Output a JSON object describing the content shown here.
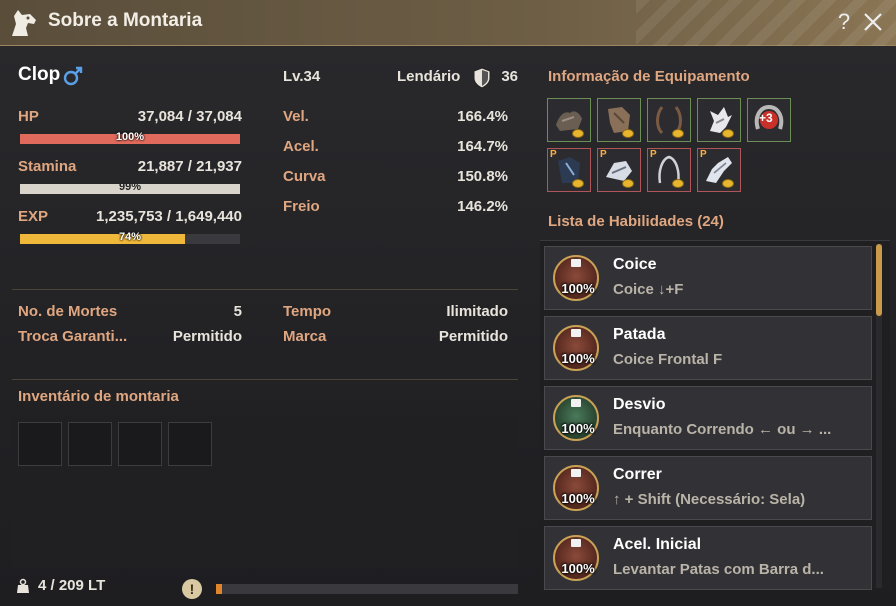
{
  "window": {
    "title": "Sobre a Montaria",
    "icon": "horse-head-icon",
    "help_label": "?"
  },
  "mount": {
    "name": "Clop",
    "gender": "male",
    "level": "Lv.34",
    "grade": "Lendário",
    "armor": "36",
    "stats": {
      "hp_label": "HP",
      "hp_value": "37,084 / 37,084",
      "hp_pct_label": "100%",
      "hp_fraction": 1.0,
      "stamina_label": "Stamina",
      "stamina_value": "21,887 / 21,937",
      "stamina_pct_label": "99%",
      "stamina_fraction": 0.9977,
      "exp_label": "EXP",
      "exp_value": "1,235,753 / 1,649,440",
      "exp_pct_label": "74%",
      "exp_fraction": 0.749
    },
    "movement": [
      {
        "label": "Vel.",
        "value": "166.4%"
      },
      {
        "label": "Acel.",
        "value": "164.7%"
      },
      {
        "label": "Curva",
        "value": "150.8%"
      },
      {
        "label": "Freio",
        "value": "146.2%"
      }
    ],
    "info": {
      "deaths_label": "No. de Mortes",
      "deaths_value": "5",
      "trade_label": "Troca Garanti...",
      "trade_value": "Permitido",
      "time_label": "Tempo",
      "time_value": "Ilimitado",
      "brand_label": "Marca",
      "brand_value": "Permitido"
    }
  },
  "inventory": {
    "title": "Inventário de montaria",
    "weight": "4 / 209 LT",
    "weight_fraction": 0.019
  },
  "equipment": {
    "title": "Informação de Equipamento",
    "enhance_label": "+3",
    "row1": [
      "saddle-icon",
      "barding-icon",
      "stirrups-icon",
      "horseshoe-icon",
      "enhanced-horseshoe-icon"
    ],
    "row2": [
      "pearl-barding-icon",
      "pearl-saddle-icon",
      "pearl-stirrups-icon",
      "pearl-champron-icon"
    ],
    "pearl_mark": "P"
  },
  "skills": {
    "title": "Lista de Habilidades (24)",
    "items": [
      {
        "name": "Coice",
        "desc": "Coice ↓+F",
        "pct": "100%"
      },
      {
        "name": "Patada",
        "desc": "Coice Frontal F",
        "pct": "100%"
      },
      {
        "name": "Desvio",
        "desc": "Enquanto Correndo ← ou → ...",
        "pct": "100%"
      },
      {
        "name": "Correr",
        "desc": "↑ + Shift (Necessário: Sela)",
        "pct": "100%"
      },
      {
        "name": "Acel. Inicial",
        "desc": "Levantar Patas com Barra d...",
        "pct": "100%"
      }
    ]
  },
  "colors": {
    "hp": "#e06a5c",
    "stamina": "#d8d4cc",
    "exp": "#f0b83a",
    "label": "#e0a680",
    "accent": "#c89a4a"
  }
}
